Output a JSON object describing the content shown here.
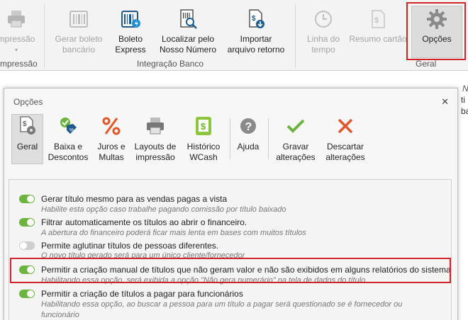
{
  "ribbon": {
    "impressao_label": "mpressão",
    "impressao_group": "mpressão",
    "gerar_boleto_label": "Gerar boleto bancário",
    "boleto_express_label": "Boleto Express",
    "localizar_label": "Localizar pelo Nosso Número",
    "importar_label": "Importar arquivo retorno",
    "integracao_group": "Integração Banco",
    "linha_tempo_label": "Linha do tempo",
    "resumo_label": "Resumo cartão",
    "opcoes_label": "Opções",
    "geral_group": "Geral"
  },
  "behind": {
    "col_header": "N",
    "cell_1": "ti",
    "cell_2": "ba"
  },
  "dialog": {
    "title": "Opções",
    "close": "✕",
    "toolbar": {
      "geral": "Geral",
      "baixa": "Baixa e Descontos",
      "juros": "Juros e Multas",
      "layouts": "Layouts de impressão",
      "historico": "Histórico WCash",
      "ajuda": "Ajuda",
      "gravar": "Gravar alterações",
      "descartar": "Descartar alterações"
    },
    "options": [
      {
        "label": "Gerar título mesmo para as vendas pagas a vista",
        "desc": "Habilite esta opção caso trabalhe pagando comissão por título baixado",
        "on": true
      },
      {
        "label": "Filtrar automaticamente os títulos ao abrir o financeiro.",
        "desc": "A abertura do financeiro poderá ficar mais lenta em bases com muitos títulos",
        "on": true
      },
      {
        "label": "Permite aglutinar títulos de pessoas diferentes.",
        "desc": "O novo título gerado será para um único cliente/fornecedor",
        "on": false
      },
      {
        "label": "Permitir a criação manual de títulos que não geram valor e não são exibidos em alguns relatórios do sistema",
        "desc": "Habilitando essa opção, será exibida a opção \"Não gera numerário\" na tela de dados do título",
        "on": true
      },
      {
        "label": "Permitir a criação de títulos a pagar para funcionários",
        "desc": "Habilitando essa opção, ao buscar a pessoa para um título a pagar será questionado se é fornecedor ou",
        "desc2": "funcionário",
        "on": true
      }
    ]
  },
  "colors": {
    "accent_green": "#6db33f",
    "highlight_red": "#d1232a",
    "icon_blue": "#1e5b8c",
    "icon_orange": "#e0572b"
  }
}
